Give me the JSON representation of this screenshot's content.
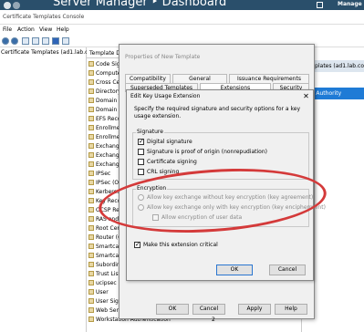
{
  "server_manager": {
    "title": "Server Manager ‣ Dashboard",
    "manage": "Manage"
  },
  "console_title": "Certificate Templates Console",
  "menu": [
    "File",
    "Action",
    "View",
    "Help"
  ],
  "tree": {
    "root": "Certificate Templates (ad1.lab.c"
  },
  "list": {
    "header": "Template Di",
    "rows": [
      "Code Sig",
      "Compute",
      "Cross Cer",
      "Directory",
      "Domain C",
      "Domain C",
      "EFS Recov",
      "Enrollmen",
      "Enrollmen",
      "Exchange",
      "Exchange",
      "Exchange",
      "IPSec",
      "IPSec (O",
      "Kerberos",
      "Key Recov",
      "OCSP Re",
      "RAS and I",
      "Root Cert",
      "Router (O",
      "Smartcar",
      "Smartcar",
      "Subordin",
      "Trust List",
      "ucipsec",
      "User",
      "User Sign",
      "Web Server",
      "Workstation Authentication"
    ],
    "last_row_value": "2"
  },
  "actions": {
    "header": "Templates (ad1.lab.co",
    "selected": "tion Authority"
  },
  "properties": {
    "title": "Properties of New Template",
    "tabs_row1": [
      "Compatibility",
      "General",
      "Issuance Requirements"
    ],
    "tabs_row2": [
      "Superseded Templates",
      "Extensions",
      "Security"
    ],
    "buttons": {
      "ok": "OK",
      "cancel": "Cancel",
      "apply": "Apply",
      "help": "Help"
    }
  },
  "key_usage": {
    "title": "Edit Key Usage Extension",
    "close": "✕",
    "description": "Specify the required signature and security options for a key usage extension.",
    "signature": {
      "label": "Signature",
      "digital_signature": "Digital signature",
      "nonrepudiation": "Signature is proof of origin (nonrepudiation)",
      "cert_signing": "Certificate signing",
      "crl_signing": "CRL signing"
    },
    "encryption": {
      "label": "Encryption",
      "opt1": "Allow key exchange without key encryption (key agreement)",
      "opt2": "Allow key exchange only with key encryption (key encipherment)",
      "user_data": "Allow encryption of user data"
    },
    "critical": "Make this extension critical",
    "ok": "OK",
    "cancel": "Cancel"
  },
  "colors": {
    "server_manager_bar": "#2a4f6b",
    "annotation": "#d43a3a",
    "selection": "#1f7bd6"
  }
}
